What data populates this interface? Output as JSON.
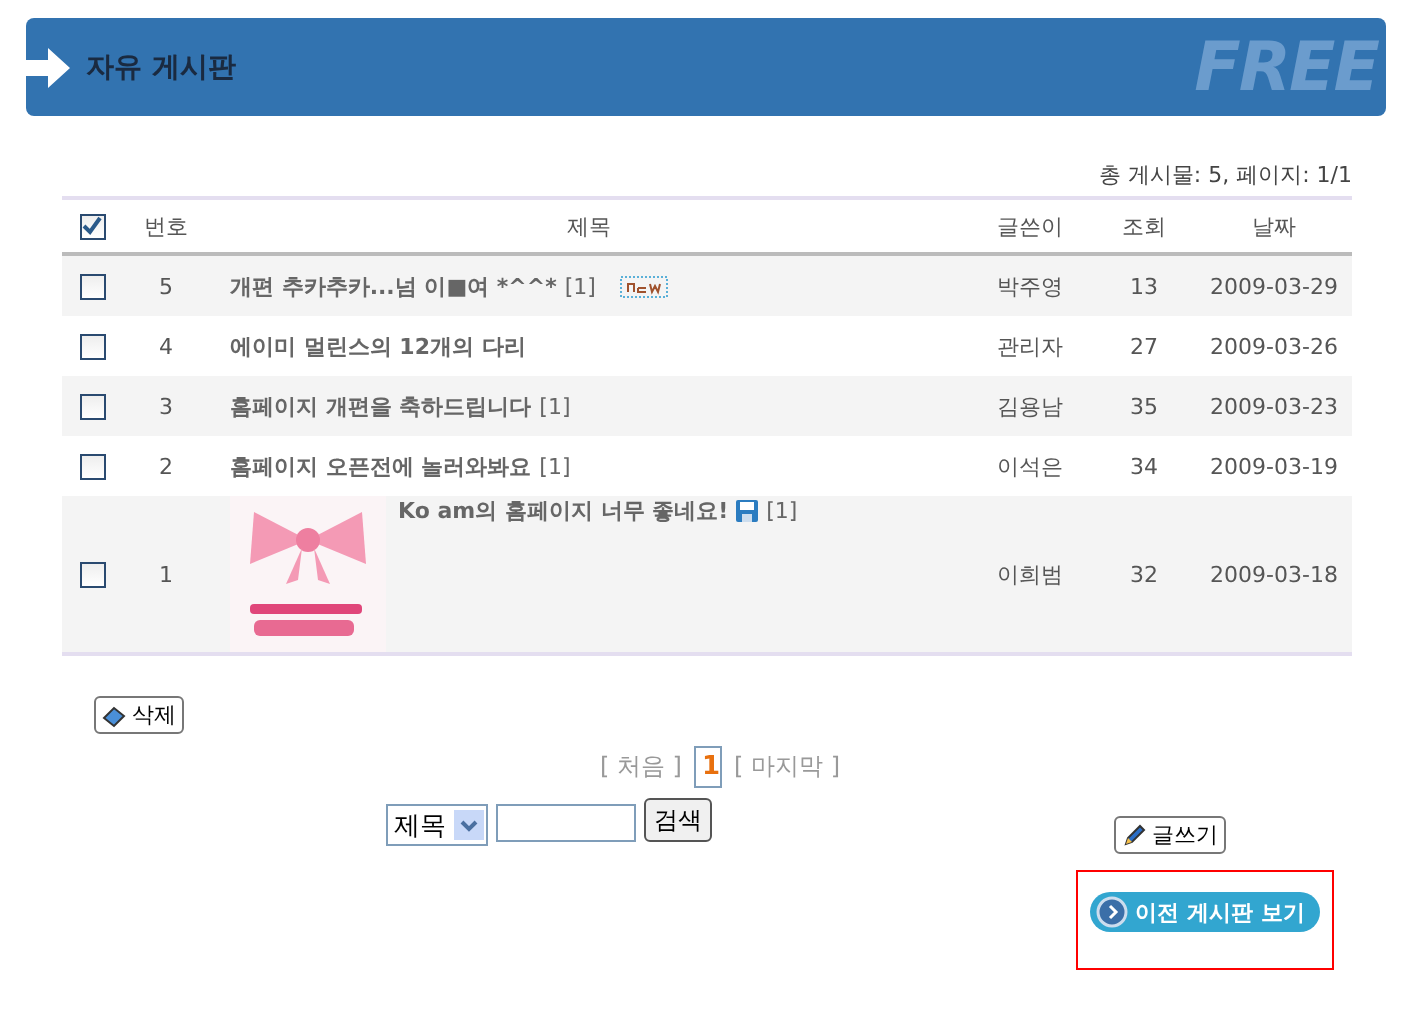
{
  "header": {
    "title": "자유 게시판",
    "watermark": "FREE"
  },
  "summary": "총 게시물: 5, 페이지: 1/1",
  "table": {
    "select_all_checked": true,
    "columns": [
      "번호",
      "제목",
      "글쓴이",
      "조회",
      "날짜"
    ],
    "rows": [
      {
        "checked": false,
        "number": "5",
        "title": "개편 추카추카...넘 이■여 *^^*",
        "comments": "[1]",
        "new": true,
        "file": false,
        "thumbnail": false,
        "author": "박주영",
        "views": "13",
        "date": "2009-03-29"
      },
      {
        "checked": false,
        "number": "4",
        "title": "에이미 멀린스의 12개의 다리",
        "new": false,
        "file": false,
        "thumbnail": false,
        "author": "관리자",
        "views": "27",
        "date": "2009-03-26"
      },
      {
        "checked": false,
        "number": "3",
        "title": "홈페이지 개편을 축하드립니다",
        "comments": "[1]",
        "new": false,
        "file": false,
        "thumbnail": false,
        "author": "김용남",
        "views": "35",
        "date": "2009-03-23"
      },
      {
        "checked": false,
        "number": "2",
        "title": "홈페이지 오픈전에 놀러와봐요",
        "comments": "[1]",
        "new": false,
        "file": false,
        "thumbnail": false,
        "author": "이석은",
        "views": "34",
        "date": "2009-03-19"
      },
      {
        "checked": false,
        "number": "1",
        "title": "Ko am의 홈페이지 너무 좋네요!",
        "comments": "[1]",
        "new": false,
        "file": true,
        "thumbnail": true,
        "author": "이희범",
        "views": "32",
        "date": "2009-03-18"
      }
    ]
  },
  "delete_button": "삭제",
  "pagination": {
    "first": "[ 처음 ]",
    "pages": [
      {
        "label": "1",
        "selected": true
      }
    ],
    "last": "[ 마지막 ]"
  },
  "search": {
    "field_select": "제목",
    "button": "검색"
  },
  "write_button": "글쓰기",
  "previous_board_button": "이전 게시판 보기"
}
